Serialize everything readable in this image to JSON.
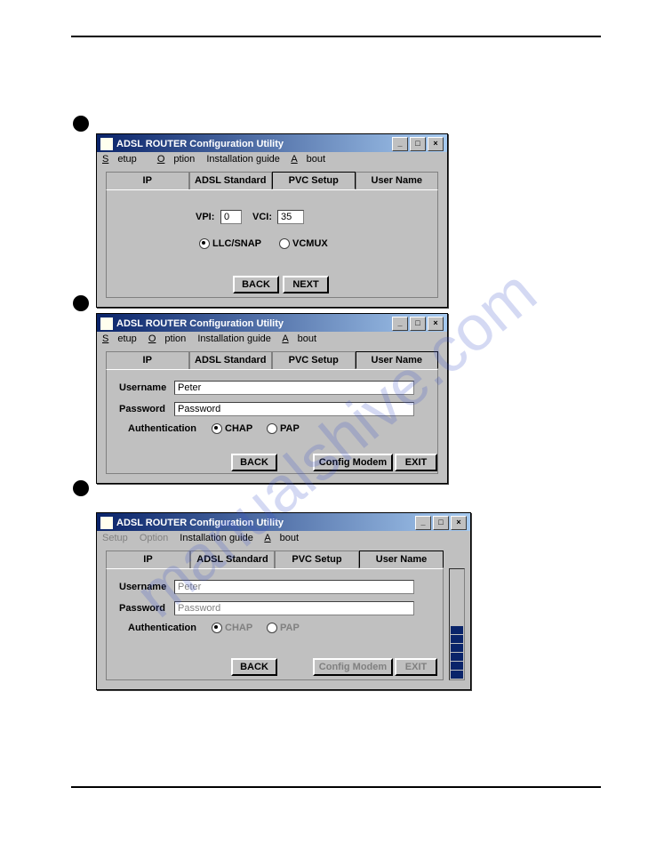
{
  "watermark": "manualshive.com",
  "windows": {
    "title": "ADSL ROUTER Configuration Utility",
    "min": "_",
    "max": "□",
    "close": "×"
  },
  "menu": {
    "setup": "Setup",
    "option": "Option",
    "install": "Installation guide",
    "about": "About"
  },
  "tabs": {
    "ip": "IP",
    "adsl": "ADSL Standard",
    "pvc": "PVC Setup",
    "user": "User Name"
  },
  "pvc": {
    "vpi_label": "VPI:",
    "vpi_value": "0",
    "vci_label": "VCI:",
    "vci_value": "35",
    "llc": "LLC/SNAP",
    "vcmux": "VCMUX",
    "back": "BACK",
    "next": "NEXT"
  },
  "user": {
    "username_label": "Username",
    "username_value": "Peter",
    "password_label": "Password",
    "password_value": "Password",
    "auth_label": "Authentication",
    "chap": "CHAP",
    "pap": "PAP",
    "back": "BACK",
    "config": "Config Modem",
    "exit": "EXIT"
  }
}
